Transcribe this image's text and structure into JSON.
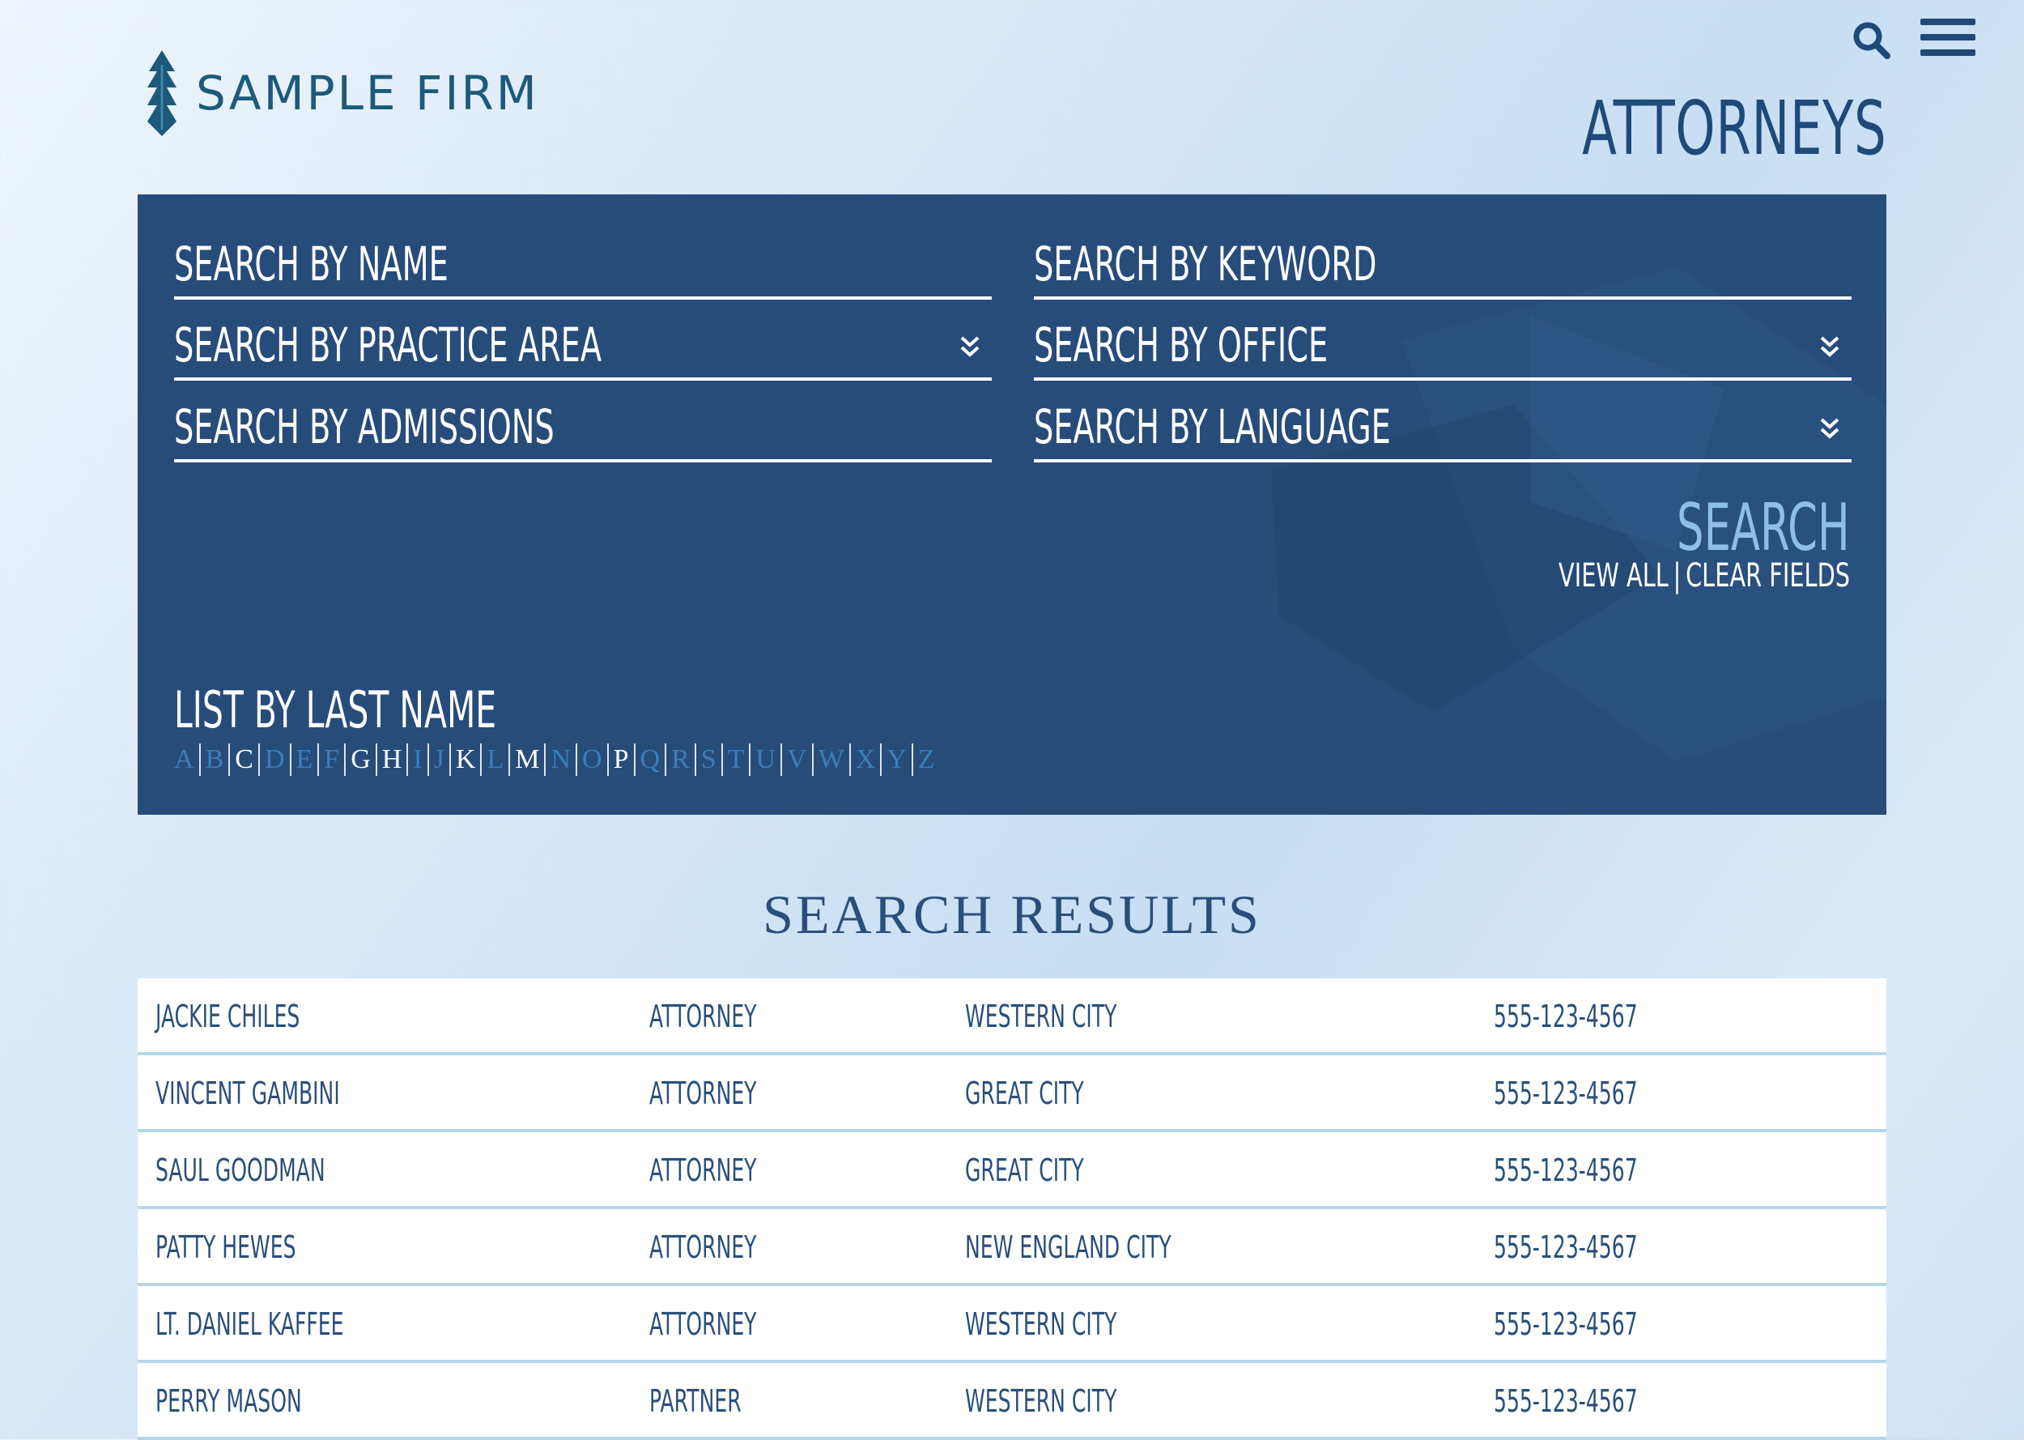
{
  "brand": {
    "name": "SAMPLE FIRM",
    "color": "#1d5a79"
  },
  "header": {
    "page_title": "ATTORNEYS",
    "search_icon": "search-icon",
    "menu_icon": "hamburger-menu-icon"
  },
  "search_panel": {
    "background": "#274c7a",
    "fields": {
      "name": "SEARCH BY NAME",
      "keyword": "SEARCH BY KEYWORD",
      "practice_area": "SEARCH BY PRACTICE AREA",
      "office": "SEARCH BY OFFICE",
      "admissions": "SEARCH BY ADMISSIONS",
      "language": "SEARCH BY LANGUAGE"
    },
    "search_label": "SEARCH",
    "view_all": "VIEW ALL",
    "link_separator": "|",
    "clear_fields": "CLEAR FIELDS",
    "list_title": "LIST BY LAST NAME",
    "alphabet": [
      {
        "letter": "A",
        "active": false
      },
      {
        "letter": "B",
        "active": false
      },
      {
        "letter": "C",
        "active": true
      },
      {
        "letter": "D",
        "active": false
      },
      {
        "letter": "E",
        "active": false
      },
      {
        "letter": "F",
        "active": false
      },
      {
        "letter": "G",
        "active": true
      },
      {
        "letter": "H",
        "active": true
      },
      {
        "letter": "I",
        "active": false
      },
      {
        "letter": "J",
        "active": false
      },
      {
        "letter": "K",
        "active": true
      },
      {
        "letter": "L",
        "active": false
      },
      {
        "letter": "M",
        "active": true
      },
      {
        "letter": "N",
        "active": false
      },
      {
        "letter": "O",
        "active": false
      },
      {
        "letter": "P",
        "active": true
      },
      {
        "letter": "Q",
        "active": false
      },
      {
        "letter": "R",
        "active": false
      },
      {
        "letter": "S",
        "active": false
      },
      {
        "letter": "T",
        "active": false
      },
      {
        "letter": "U",
        "active": false
      },
      {
        "letter": "V",
        "active": false
      },
      {
        "letter": "W",
        "active": false
      },
      {
        "letter": "X",
        "active": false
      },
      {
        "letter": "Y",
        "active": false
      },
      {
        "letter": "Z",
        "active": false
      }
    ]
  },
  "results": {
    "title": "SEARCH RESULTS",
    "rows": [
      {
        "name": "JACKIE CHILES",
        "title": "ATTORNEY",
        "office": "WESTERN CITY",
        "phone": "555-123-4567"
      },
      {
        "name": "VINCENT GAMBINI",
        "title": "ATTORNEY",
        "office": "GREAT CITY",
        "phone": "555-123-4567"
      },
      {
        "name": "SAUL GOODMAN",
        "title": "ATTORNEY",
        "office": "GREAT CITY",
        "phone": "555-123-4567"
      },
      {
        "name": "PATTY HEWES",
        "title": "ATTORNEY",
        "office": "NEW ENGLAND CITY",
        "phone": "555-123-4567"
      },
      {
        "name": "LT. DANIEL KAFFEE",
        "title": "ATTORNEY",
        "office": "WESTERN CITY",
        "phone": "555-123-4567"
      },
      {
        "name": "PERRY MASON",
        "title": "PARTNER",
        "office": "WESTERN CITY",
        "phone": "555-123-4567"
      }
    ]
  }
}
